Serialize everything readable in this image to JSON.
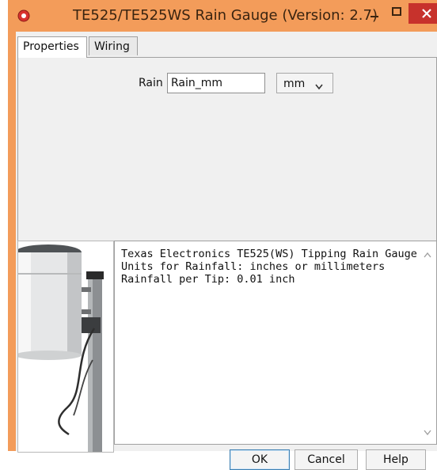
{
  "window": {
    "title": "TE525/TE525WS Rain Gauge (Version: 2.7)",
    "icon": "app-record-icon",
    "colors": {
      "titlebar": "#f39c5a",
      "close": "#c7322c"
    }
  },
  "tabs": [
    {
      "label": "Properties",
      "active": true
    },
    {
      "label": "Wiring",
      "active": false
    }
  ],
  "properties": {
    "rain_label": "Rain",
    "rain_value": "Rain_mm",
    "units_selected": "mm"
  },
  "description": {
    "lines": [
      "Texas Electronics TE525(WS) Tipping Rain Gauge",
      "Units for Rainfall: inches or millimeters",
      "Rainfall per Tip: 0.01 inch"
    ]
  },
  "buttons": {
    "ok": "OK",
    "cancel": "Cancel",
    "help": "Help"
  }
}
